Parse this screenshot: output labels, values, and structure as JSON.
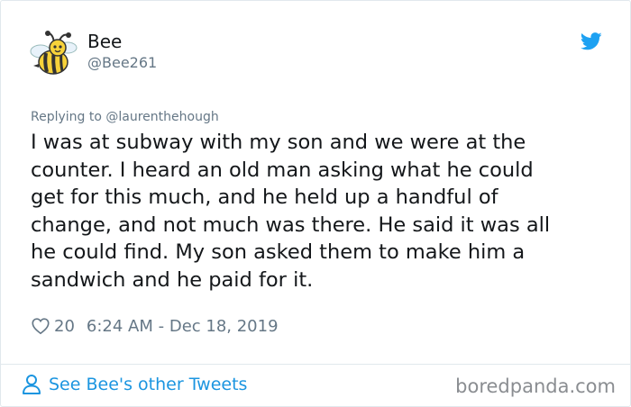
{
  "author": {
    "name": "Bee",
    "handle": "@Bee261",
    "avatar_icon": "bee-avatar-icon"
  },
  "platform_icon": "twitter-bird-icon",
  "reply": {
    "text": "Replying to @laurenthehough"
  },
  "tweet": {
    "text": "I was at subway with my son and we were at the\ncounter. I heard an old man asking what he could\nget for this much, and he held up a handful of\nchange, and not much was there. He said it was all\nhe could find. My son asked them to make him a\nsandwich and he paid for it."
  },
  "meta": {
    "likes": "20",
    "timestamp": "6:24 AM - Dec 18, 2019"
  },
  "footer": {
    "see_more_label": "See Bee's other Tweets",
    "watermark": "boredpanda.com"
  },
  "colors": {
    "twitter_blue": "#1da1f2",
    "link_blue": "#1b95e0",
    "secondary_text": "#657786",
    "primary_text": "#14171a"
  }
}
